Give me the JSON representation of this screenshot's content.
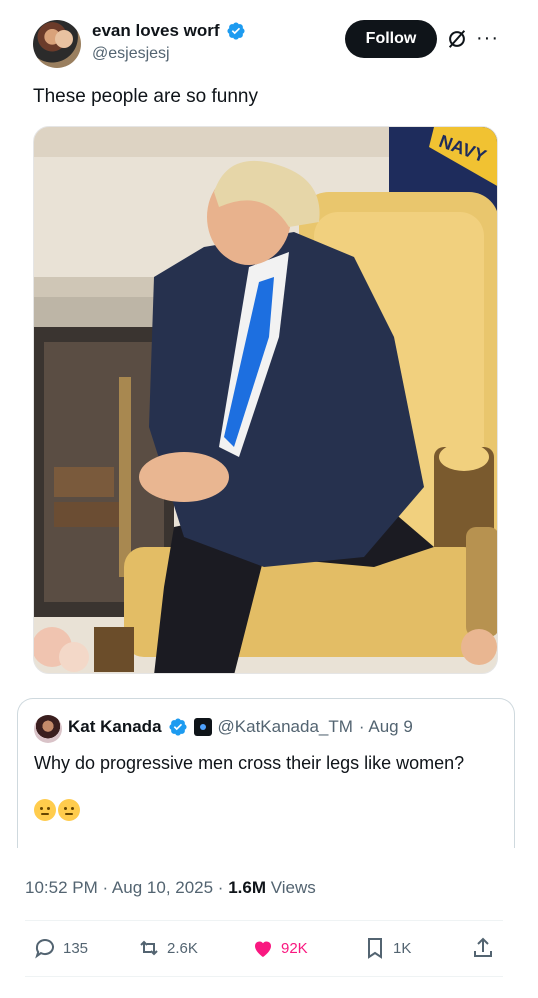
{
  "header": {
    "display_name": "evan loves worf",
    "handle": "@esjesjesj",
    "follow_label": "Follow",
    "more_label": "···"
  },
  "post": {
    "text": "These people are so funny"
  },
  "quote": {
    "name": "Kat Kanada",
    "handle": "@KatKanada_TM",
    "date": "· Aug 9",
    "text": "Why do progressive men cross their legs like women?"
  },
  "meta": {
    "time": "10:52 PM · Aug 10, 2025 · ",
    "views_count": "1.6M",
    "views_label": " Views"
  },
  "actions": {
    "replies": "135",
    "reposts": "2.6K",
    "likes": "92K",
    "bookmarks": "1K"
  },
  "colors": {
    "accent": "#1d9bf0",
    "like": "#f91880",
    "muted": "#536471"
  },
  "media": {
    "flag_text": "NAVY"
  }
}
